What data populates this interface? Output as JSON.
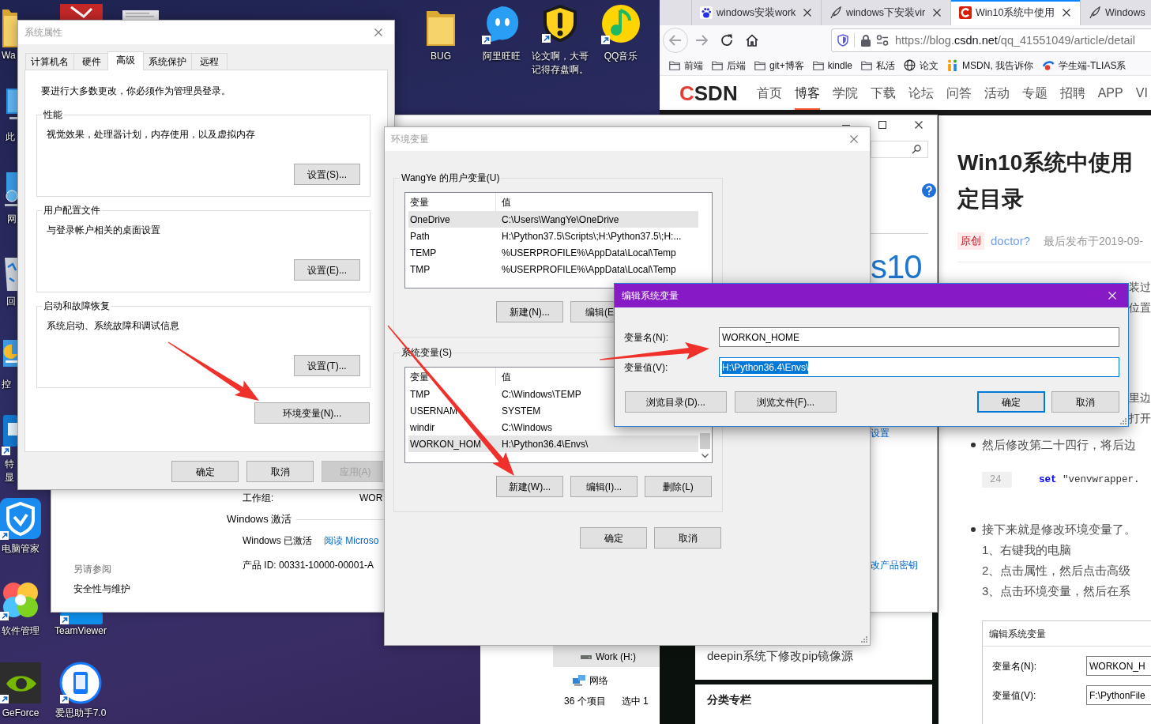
{
  "desktop": {
    "icons": [
      {
        "label": "Wa"
      },
      {
        "label": "此"
      },
      {
        "label": "网"
      },
      {
        "label": "回"
      },
      {
        "label": "控"
      },
      {
        "label": "特显"
      },
      {
        "label": "电脑管家"
      },
      {
        "label": "软件管理"
      },
      {
        "label": "TeamViewer"
      },
      {
        "label": "GeForce"
      },
      {
        "label": "爱思助手7.0"
      },
      {
        "label": "BUG"
      },
      {
        "label": "阿里旺旺"
      },
      {
        "label": "论文啊，大哥记得存盘啊。"
      },
      {
        "label": "QQ音乐"
      }
    ]
  },
  "explorer": {
    "nav_items": [
      {
        "kind": "drive",
        "label": "Work (H:)",
        "selected": true
      },
      {
        "kind": "network",
        "label": "网络",
        "selected": false
      }
    ],
    "status_items": [
      "36 个项目",
      "选中 1"
    ]
  },
  "browser": {
    "tabs": [
      {
        "title": "windows安装work",
        "selected": false
      },
      {
        "title": "windows下安装vir",
        "selected": false
      },
      {
        "title": "Win10系统中使用",
        "selected": true
      },
      {
        "title": "Windows",
        "selected": false
      }
    ],
    "address": "https://blog.**csdn.net**/qq_41551049/article/detail",
    "bookmarks": [
      {
        "kind": "folder",
        "label": "前端"
      },
      {
        "kind": "folder",
        "label": "后端"
      },
      {
        "kind": "folder",
        "label": "git+博客"
      },
      {
        "kind": "folder",
        "label": "kindle"
      },
      {
        "kind": "folder",
        "label": "私活"
      },
      {
        "kind": "site",
        "label": "论文"
      },
      {
        "kind": "site",
        "label": "MSDN, 我告诉你"
      },
      {
        "kind": "site",
        "label": "学生端-TLIAS系"
      }
    ],
    "site_logo": "CSDN",
    "site_nav": [
      {
        "label": "首页",
        "selected": false
      },
      {
        "label": "博客",
        "selected": true
      },
      {
        "label": "学院",
        "selected": false
      },
      {
        "label": "下载",
        "selected": false
      },
      {
        "label": "论坛",
        "selected": false
      },
      {
        "label": "问答",
        "selected": false
      },
      {
        "label": "活动",
        "selected": false
      },
      {
        "label": "专题",
        "selected": false
      },
      {
        "label": "招聘",
        "selected": false
      },
      {
        "label": "APP",
        "selected": false
      },
      {
        "label": "VI",
        "selected": false
      }
    ],
    "sidebar": {
      "article_link": "deepin系统下修改pip镜像源",
      "section_heading": "分类专栏"
    },
    "article": {
      "title_lines": [
        "Win10系统中使用",
        "定目录"
      ],
      "tag": "原创",
      "author": "doctor?",
      "date": "最后发布于2019-09-",
      "blocks": [
        {
          "kind": "fragment",
          "text": "装过"
        },
        {
          "kind": "fragment",
          "text": "位置"
        },
        {
          "kind": "fragment",
          "text": "里边"
        },
        {
          "kind": "fragment",
          "text": "打开"
        },
        {
          "kind": "bullet",
          "text": "然后修改第二十四行，将后边"
        },
        {
          "kind": "code",
          "line_number": "24",
          "code": "**set** \"venvwrapper."
        },
        {
          "kind": "bullet",
          "text": "接下来就是修改环境变量了。"
        },
        {
          "kind": "step",
          "text": "1、右键我的电脑"
        },
        {
          "kind": "step",
          "text": "2、点击属性，然后点击高级"
        },
        {
          "kind": "step",
          "text": "3、点击环境变量，然后在系"
        }
      ],
      "figure": {
        "title": "编辑系统变量",
        "fields": [
          {
            "label": "变量名(N):",
            "value": "WORKON_H"
          },
          {
            "label": "变量值(V):",
            "value": "F:\\PythonFile"
          }
        ]
      }
    }
  },
  "control_panel": {
    "see_also_heading": "另请参阅",
    "see_also_links": [
      "安全性与维护"
    ],
    "workgroup_label": "工作组:",
    "workgroup_value": "WOR",
    "activation_heading": "Windows 激活",
    "activation_status": "Windows 已激活",
    "activation_link": "阅读 Microso",
    "product_id": "产品 ID: 00331-10000-00001-A",
    "logo_text": "s10",
    "settings_link": "设置",
    "product_key_link": "改产品密钥"
  },
  "system_properties": {
    "title": "系统属性",
    "tabs": [
      {
        "label": "计算机名",
        "selected": false
      },
      {
        "label": "硬件",
        "selected": false
      },
      {
        "label": "高级",
        "selected": true
      },
      {
        "label": "系统保护",
        "selected": false
      },
      {
        "label": "远程",
        "selected": false
      }
    ],
    "notice": "要进行大多数更改，你必须作为管理员登录。",
    "groups": [
      {
        "title": "性能",
        "description": "视觉效果，处理器计划，内存使用，以及虚拟内存",
        "button": "设置(S)..."
      },
      {
        "title": "用户配置文件",
        "description": "与登录帐户相关的桌面设置",
        "button": "设置(E)..."
      },
      {
        "title": "启动和故障恢复",
        "description": "系统启动、系统故障和调试信息",
        "button": "设置(T)..."
      }
    ],
    "env_button": "环境变量(N)...",
    "buttons": [
      {
        "label": "确定",
        "disabled": false
      },
      {
        "label": "取消",
        "disabled": false
      },
      {
        "label": "应用(A)",
        "disabled": true
      }
    ]
  },
  "environment_variables": {
    "title": "环境变量",
    "user_group": {
      "title": "WangYe 的用户变量(U)",
      "columns": [
        "变量",
        "值"
      ],
      "rows": [
        {
          "name": "OneDrive",
          "value": "C:\\Users\\WangYe\\OneDrive",
          "selected": true
        },
        {
          "name": "Path",
          "value": "H:\\Python37.5\\Scripts\\;H:\\Python37.5\\;H:...",
          "selected": false
        },
        {
          "name": "TEMP",
          "value": "%USERPROFILE%\\AppData\\Local\\Temp",
          "selected": false
        },
        {
          "name": "TMP",
          "value": "%USERPROFILE%\\AppData\\Local\\Temp",
          "selected": false
        }
      ],
      "buttons": [
        "新建(N)...",
        "编辑(E"
      ]
    },
    "system_group": {
      "title": "系统变量(S)",
      "columns": [
        "变量",
        "值"
      ],
      "rows": [
        {
          "name": "TMP",
          "value": "C:\\Windows\\TEMP",
          "selected": false
        },
        {
          "name": "USERNAM",
          "value": "SYSTEM",
          "selected": false
        },
        {
          "name": "windir",
          "value": "C:\\Windows",
          "selected": false
        },
        {
          "name": "WORKON_HOM",
          "value": "H:\\Python36.4\\Envs\\",
          "selected": true
        }
      ],
      "buttons": [
        "新建(W)...",
        "编辑(I)...",
        "删除(L)"
      ]
    },
    "buttons": [
      "确定",
      "取消"
    ]
  },
  "edit_dialog": {
    "title": "编辑系统变量",
    "fields": [
      {
        "label": "变量名(N):",
        "value": "WORKON_HOME",
        "focused": false
      },
      {
        "label": "变量值(V):",
        "value": "H:\\Python36.4\\Envs\\",
        "focused": true
      }
    ],
    "buttons": [
      {
        "label": "浏览目录(D)...",
        "default": false
      },
      {
        "label": "浏览文件(F)...",
        "default": false
      },
      {
        "label": "确定",
        "default": true
      },
      {
        "label": "取消",
        "default": false
      }
    ]
  }
}
